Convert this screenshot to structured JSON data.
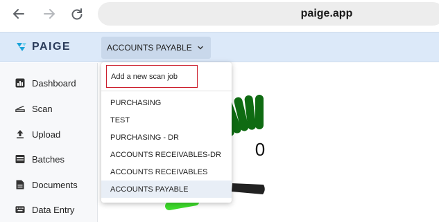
{
  "browser": {
    "url": "paige.app",
    "icons": [
      "back-arrow-icon",
      "forward-arrow-icon",
      "reload-icon"
    ]
  },
  "header": {
    "logo_text": "PAIGE",
    "queue_selected": "ACCOUNTS PAYABLE",
    "queue_chevron": "chevron-down-icon"
  },
  "sidebar": {
    "items": [
      {
        "label": "Dashboard",
        "icon": "bar-chart-icon"
      },
      {
        "label": "Scan",
        "icon": "scanner-icon"
      },
      {
        "label": "Upload",
        "icon": "upload-icon"
      },
      {
        "label": "Batches",
        "icon": "archive-box-icon"
      },
      {
        "label": "Documents",
        "icon": "document-icon"
      },
      {
        "label": "Data Entry",
        "icon": "keyboard-icon"
      }
    ]
  },
  "dropdown": {
    "add_label": "Add a new scan job",
    "options": [
      "PURCHASING",
      "TEST",
      "PURCHASING - DR",
      "ACCOUNTS RECEIVABLES-DR",
      "ACCOUNTS RECEIVABLES",
      "ACCOUNTS PAYABLE"
    ],
    "selected": "ACCOUNTS PAYABLE"
  },
  "gauge": {
    "value": "0",
    "colors": {
      "light": "#3ddc2b",
      "dark": "#0f6b12",
      "needle": "#222222"
    }
  },
  "colors": {
    "header_bg": "#dce9f9",
    "highlight_border": "#cc1f2d",
    "logo_accent": "#1aa3d9"
  }
}
